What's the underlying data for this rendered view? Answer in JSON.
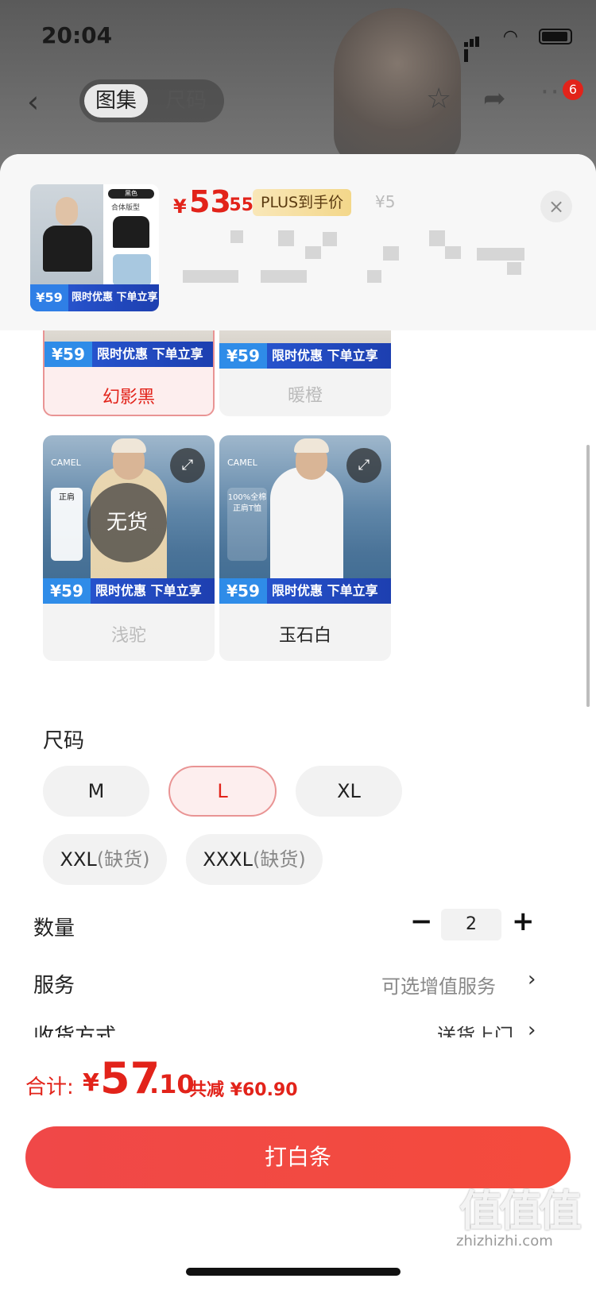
{
  "status_bar": {
    "time": "20:04"
  },
  "nav": {
    "tabs": [
      "图集",
      "尺码"
    ],
    "cart_badge": "6"
  },
  "header": {
    "price_symbol": "¥",
    "price_int": "53",
    "price_dec": ".55",
    "plus_tag": "PLUS到手价",
    "orig_price": "¥5",
    "thumb_tag": "黑色",
    "thumb_sub": "合体版型",
    "thumb_promo_price": "59",
    "thumb_promo_text": "限时优惠 下单立享",
    "close_icon": "×"
  },
  "colors": {
    "items": [
      {
        "name": "幻影黑",
        "promo_price": "¥59",
        "promo_text": "限时优惠 下单立享",
        "state": "selected"
      },
      {
        "name": "暖橙",
        "promo_price": "¥59",
        "promo_text": "限时优惠 下单立享",
        "state": "disabled"
      },
      {
        "name": "浅驼",
        "promo_price": "¥59",
        "promo_text": "限时优惠 下单立享",
        "state": "disabled",
        "overlay": "无货"
      },
      {
        "name": "玉石白",
        "promo_price": "¥59",
        "promo_text": "限时优惠 下单立享",
        "state": "normal"
      }
    ],
    "brand": "CAMEL",
    "feature_1": "正肩",
    "feature_2": "100%全棉\n正肩T恤"
  },
  "size": {
    "label": "尺码",
    "options": [
      "M",
      "L",
      "XL",
      "XXL",
      "XXXL"
    ],
    "out_of_stock_suffix": "(缺货)",
    "selected": "L"
  },
  "quantity": {
    "label": "数量",
    "value": "2",
    "minus": "−",
    "plus": "+"
  },
  "service": {
    "label": "服务",
    "value": "可选增值服务",
    "chevron": "›"
  },
  "delivery": {
    "label": "收货方式",
    "value": "送货上门",
    "chevron": "›"
  },
  "footer": {
    "total_label": "合计:",
    "total_symbol": "¥",
    "total_int": "57",
    "total_dec": ".10",
    "discount": "共减 ¥60.90",
    "pay_button": "打白条"
  },
  "watermark": {
    "logo": "值值值",
    "url": "zhizhizhi.com"
  },
  "colors_theme": {
    "accent": "#e2231a",
    "selected_bg": "#fdeeee",
    "promo_blue": "#2a5bd7"
  }
}
